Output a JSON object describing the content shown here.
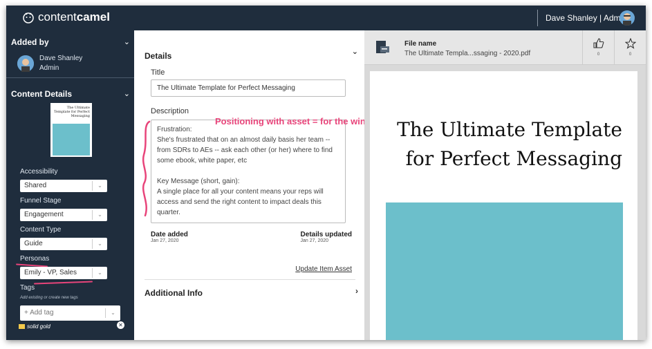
{
  "topbar": {
    "logo_light": "content",
    "logo_bold": "camel",
    "user_label": "Dave Shanley | Admin"
  },
  "sidebar": {
    "added_by_heading": "Added by",
    "person_name": "Dave Shanley",
    "person_role": "Admin",
    "content_details_heading": "Content Details",
    "thumb_title": "The Ultimate Template for Perfect Messaging",
    "fields": [
      {
        "label": "Accessibility",
        "value": "Shared"
      },
      {
        "label": "Funnel Stage",
        "value": "Engagement"
      },
      {
        "label": "Content Type",
        "value": "Guide"
      },
      {
        "label": "Personas",
        "value": "Emily - VP, Sales"
      }
    ],
    "tags_label": "Tags",
    "tags_hint": "Add existing or create new tags",
    "tags_placeholder": "+ Add tag",
    "tag_chip": "solid gold"
  },
  "details": {
    "heading": "Details",
    "title_label": "Title",
    "title_value": "The Ultimate Template for Perfect Messaging",
    "description_label": "Description",
    "description_value": "Frustration:\nShe's frustrated that on an almost daily basis her team --\nfrom SDRs to AEs -- ask each other (or her) where to find\nsome ebook, white paper, etc\n\nKey Message (short, gain):\nA single place for all your content means your reps will\naccess and send the right content to impact deals this\nquarter.",
    "annotation": "Positioning with asset = for the win",
    "date_added_label": "Date added",
    "date_added_value": "Jan 27, 2020",
    "details_updated_label": "Details updated",
    "details_updated_value": "Jan 27, 2020",
    "update_link": "Update Item Asset",
    "additional_info": "Additional Info"
  },
  "preview": {
    "file_name_label": "File name",
    "file_name_value": "The Ultimate Templa...ssaging - 2020.pdf",
    "like_count": "0",
    "fav_count": "0",
    "page_title": "The Ultimate Template for Perfect Messaging"
  },
  "colors": {
    "navy": "#1f2d3d",
    "teal": "#6cbfcb",
    "annotation_pink": "#e8447a",
    "tag_gold": "#f2c94c"
  }
}
